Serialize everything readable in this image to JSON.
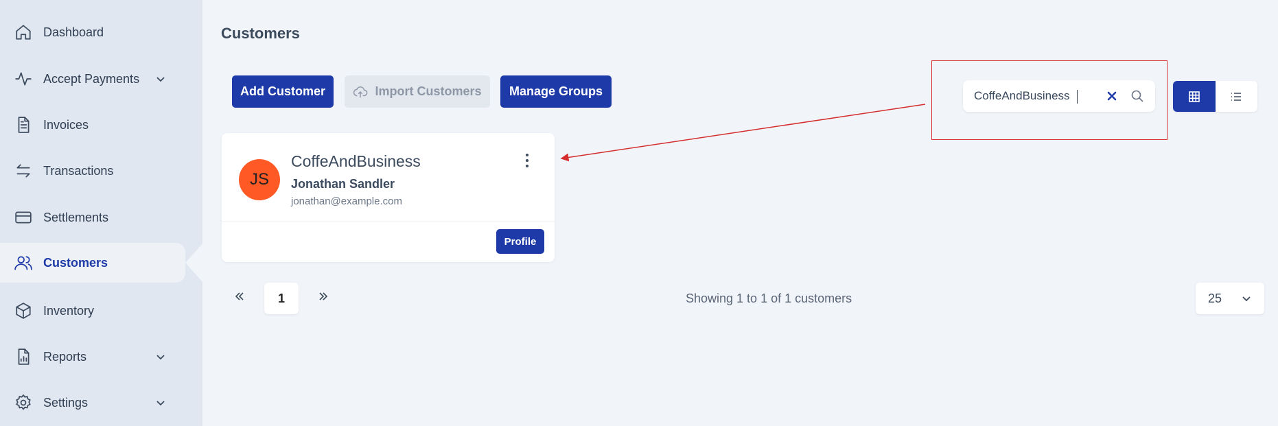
{
  "sidebar": {
    "items": [
      {
        "label": "Dashboard",
        "icon": "home-icon"
      },
      {
        "label": "Accept Payments",
        "icon": "activity-icon"
      },
      {
        "label": "Invoices",
        "icon": "document-icon"
      },
      {
        "label": "Transactions",
        "icon": "arrows-icon"
      },
      {
        "label": "Settlements",
        "icon": "card-icon"
      },
      {
        "label": "Customers",
        "icon": "users-icon"
      },
      {
        "label": "Inventory",
        "icon": "box-icon"
      },
      {
        "label": "Reports",
        "icon": "report-icon"
      },
      {
        "label": "Settings",
        "icon": "gear-icon"
      }
    ]
  },
  "page": {
    "title": "Customers"
  },
  "toolbar": {
    "add_label": "Add Customer",
    "import_label": "Import Customers",
    "groups_label": "Manage Groups"
  },
  "search": {
    "value": "CoffeAndBusiness"
  },
  "customer": {
    "initials": "JS",
    "company": "CoffeAndBusiness",
    "name": "Jonathan Sandler",
    "email": "jonathan@example.com",
    "profile_label": "Profile"
  },
  "pagination": {
    "current_page": "1",
    "summary": "Showing 1 to 1 of 1 customers",
    "per_page": "25"
  },
  "colors": {
    "accent": "#1e3aa8",
    "avatar": "#ff5a26",
    "annotation": "#d62e2e"
  }
}
